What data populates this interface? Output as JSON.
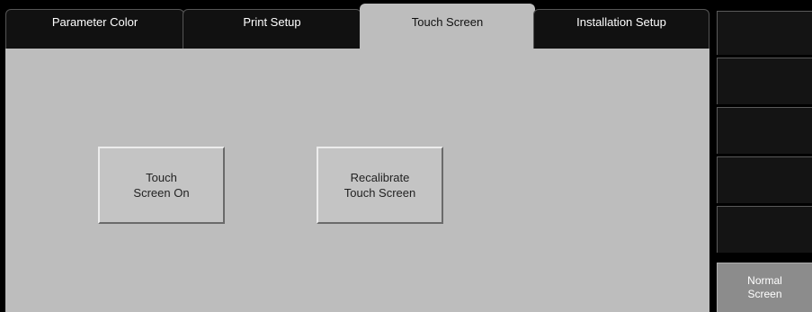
{
  "tabs": [
    {
      "label": "Parameter Color",
      "active": false
    },
    {
      "label": "Print Setup",
      "active": false
    },
    {
      "label": "Touch Screen",
      "active": true
    },
    {
      "label": "Installation Setup",
      "active": false
    }
  ],
  "panel": {
    "touch_screen_button": "Touch\nScreen On",
    "recalibrate_button": "Recalibrate\nTouch Screen"
  },
  "softkeys": {
    "key1": "",
    "key2": "",
    "key3": "",
    "key4": "",
    "key5": "",
    "normal_screen": "Normal\nScreen"
  },
  "colors": {
    "panel_bg": "#bdbdbd",
    "tab_inactive_bg": "#111111",
    "softkey_bg": "#141414",
    "normal_screen_bg": "#8c8c8c"
  }
}
